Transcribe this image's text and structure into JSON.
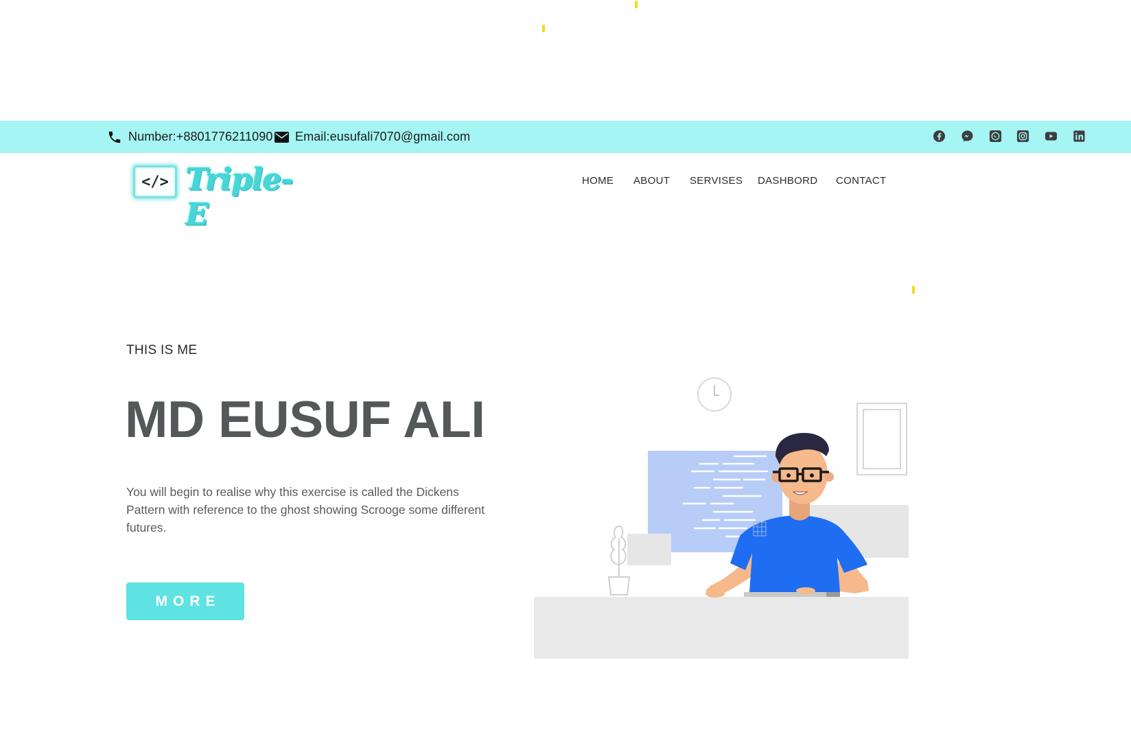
{
  "topbar": {
    "phone_label": "Number:+8801776211090",
    "email_label": "Email:eusufali7070@gmail.com",
    "socials": [
      "facebook-icon",
      "messenger-icon",
      "whatsapp-icon",
      "instagram-icon",
      "youtube-icon",
      "linkedin-icon"
    ]
  },
  "logo": {
    "code": "</>",
    "text": "Triple-E"
  },
  "nav": {
    "items": [
      "HOME",
      "ABOUT",
      "SERVISES",
      "DASHBORD",
      "CONTACT"
    ]
  },
  "hero": {
    "eyebrow": "THIS IS ME",
    "name": "MD EUSUF ALI",
    "description": "You will begin to realise why this exercise is called the Dickens Pattern with reference to the ghost showing Scrooge some different futures.",
    "button_label": "MORE"
  },
  "colors": {
    "topbar_bg": "#a5f5f5",
    "accent": "#5fe2e2",
    "title": "#555858",
    "spark": "#f2dc12"
  }
}
